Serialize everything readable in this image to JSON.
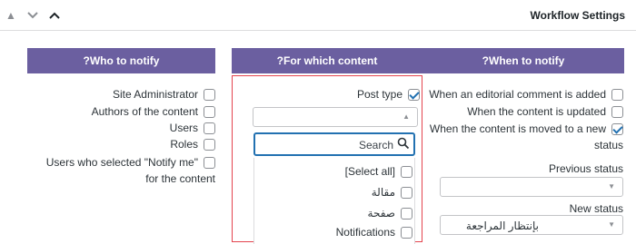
{
  "header": {
    "title": "Workflow Settings",
    "controls": [
      "chevron-up-icon",
      "chevron-down-icon",
      "chevron-up-icon"
    ]
  },
  "columns": {
    "who": {
      "title": "?Who to notify",
      "items": [
        {
          "label": "Site Administrator",
          "checked": false
        },
        {
          "label": "Authors of the content",
          "checked": false
        },
        {
          "label": "Users",
          "checked": false
        },
        {
          "label": "Roles",
          "checked": false
        },
        {
          "label": "Users who selected \"Notify me\"",
          "checked": false
        }
      ],
      "notify_me_continuation": "for the content"
    },
    "which": {
      "title": "?For which content",
      "post_type_label": "Post type",
      "post_type_checked": true,
      "search_placeholder": "Search",
      "options": [
        {
          "label": "[Select all]",
          "checked": false
        },
        {
          "label": "مقالة",
          "checked": false
        },
        {
          "label": "صفحة",
          "checked": false
        },
        {
          "label": "Notifications",
          "checked": false
        }
      ]
    },
    "when": {
      "title": "?When to notify",
      "items": [
        {
          "label": "When an editorial comment is added",
          "checked": false
        },
        {
          "label": "When the content is updated",
          "checked": false
        },
        {
          "label": "When the content is moved to a new",
          "checked": true
        }
      ],
      "status_word": "status",
      "previous_status_label": "Previous status",
      "previous_status_value": "",
      "new_status_label": "New status",
      "new_status_value": "بإنتظار المراجعة"
    }
  },
  "colors": {
    "column_header_bg": "#6b5fa0",
    "accent": "#2271b1",
    "highlight_border": "#e4444e"
  }
}
